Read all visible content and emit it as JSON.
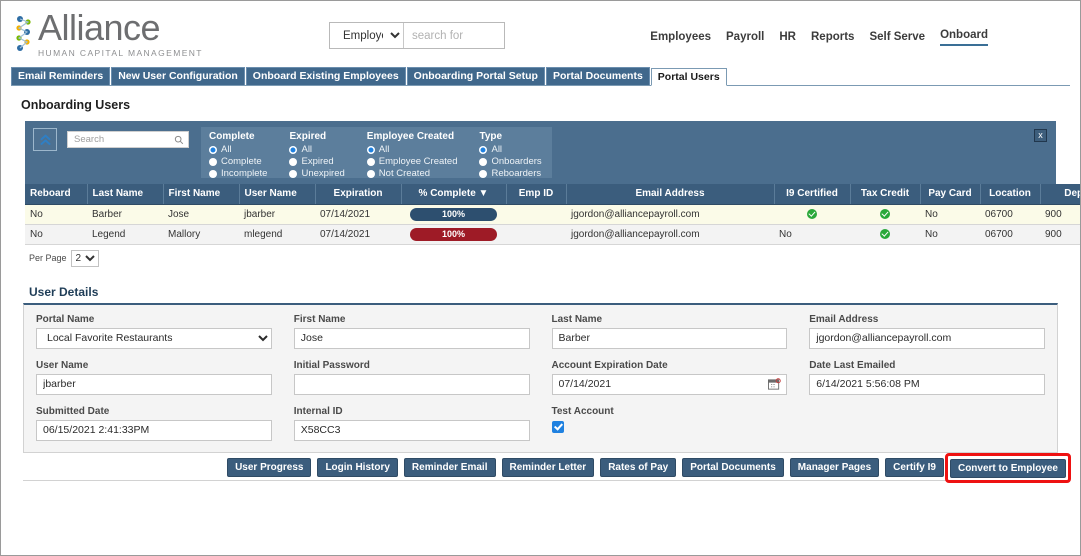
{
  "brand": {
    "name": "Alliance",
    "tagline": "HUMAN CAPITAL MANAGEMENT",
    "colors": {
      "mark_blue": "#2e6da4",
      "mark_green": "#7ab800",
      "mark_yellow": "#f2b100",
      "text_gray": "#6d6e70"
    }
  },
  "header": {
    "search_scope": "Employees",
    "search_placeholder": "search for",
    "search_value": "",
    "nav": [
      {
        "label": "Employees",
        "active": false
      },
      {
        "label": "Payroll",
        "active": false
      },
      {
        "label": "HR",
        "active": false
      },
      {
        "label": "Reports",
        "active": false
      },
      {
        "label": "Self Serve",
        "active": false
      },
      {
        "label": "Onboard",
        "active": true
      }
    ]
  },
  "tabs": [
    {
      "label": "Email Reminders",
      "active": false
    },
    {
      "label": "New User Configuration",
      "active": false
    },
    {
      "label": "Onboard Existing Employees",
      "active": false
    },
    {
      "label": "Onboarding Portal Setup",
      "active": false
    },
    {
      "label": "Portal Documents",
      "active": false
    },
    {
      "label": "Portal Users",
      "active": true
    }
  ],
  "page_title": "Onboarding Users",
  "filter": {
    "search_placeholder": "Search",
    "search_value": "",
    "close_label": "x",
    "groups": [
      {
        "title": "Complete",
        "options": [
          {
            "label": "All",
            "selected": true
          },
          {
            "label": "Complete",
            "selected": false
          },
          {
            "label": "Incomplete",
            "selected": false
          }
        ]
      },
      {
        "title": "Expired",
        "options": [
          {
            "label": "All",
            "selected": true
          },
          {
            "label": "Expired",
            "selected": false
          },
          {
            "label": "Unexpired",
            "selected": false
          }
        ]
      },
      {
        "title": "Employee Created",
        "options": [
          {
            "label": "All",
            "selected": true
          },
          {
            "label": "Employee Created",
            "selected": false
          },
          {
            "label": "Not Created",
            "selected": false
          }
        ]
      },
      {
        "title": "Type",
        "options": [
          {
            "label": "All",
            "selected": true
          },
          {
            "label": "Onboarders",
            "selected": false
          },
          {
            "label": "Reboarders",
            "selected": false
          }
        ]
      }
    ]
  },
  "table": {
    "columns": [
      "Reboard",
      "Last Name",
      "First Name",
      "User Name",
      "Expiration",
      "% Complete ▼",
      "Emp ID",
      "Email Address",
      "I9 Certified",
      "Tax Credit",
      "Pay Card",
      "Location",
      "Depa"
    ],
    "rows": [
      {
        "reboard": "No",
        "last_name": "Barber",
        "first_name": "Jose",
        "user_name": "jbarber",
        "expiration": "07/14/2021",
        "pct_label": "100%",
        "pct_color": "#2d4f6f",
        "emp_id": "",
        "email": "jgordon@alliancepayroll.com",
        "i9_certified": "check",
        "tax_credit": "check",
        "pay_card": "No",
        "location": "06700",
        "department": "900"
      },
      {
        "reboard": "No",
        "last_name": "Legend",
        "first_name": "Mallory",
        "user_name": "mlegend",
        "expiration": "07/14/2021",
        "pct_label": "100%",
        "pct_color": "#9e1b26",
        "emp_id": "",
        "email": "jgordon@alliancepayroll.com",
        "i9_certified": "No",
        "tax_credit": "check",
        "pay_card": "No",
        "location": "06700",
        "department": "900"
      }
    ],
    "per_page_label": "Per Page",
    "per_page_value": "2"
  },
  "details": {
    "title": "User Details",
    "fields": [
      {
        "label": "Portal Name",
        "value": "Local Favorite Restaurants",
        "kind": "select"
      },
      {
        "label": "First Name",
        "value": "Jose",
        "kind": "text"
      },
      {
        "label": "Last Name",
        "value": "Barber",
        "kind": "text"
      },
      {
        "label": "Email Address",
        "value": "jgordon@alliancepayroll.com",
        "kind": "text"
      },
      {
        "label": "User Name",
        "value": "jbarber",
        "kind": "text"
      },
      {
        "label": "Initial Password",
        "value": "",
        "kind": "text"
      },
      {
        "label": "Account Expiration Date",
        "value": "07/14/2021",
        "kind": "date"
      },
      {
        "label": "Date Last Emailed",
        "value": "6/14/2021 5:56:08 PM",
        "kind": "text"
      },
      {
        "label": "Submitted Date",
        "value": "06/15/2021 2:41:33PM",
        "kind": "text"
      },
      {
        "label": "Internal ID",
        "value": "X58CC3",
        "kind": "text"
      },
      {
        "label": "Test Account",
        "value": "",
        "kind": "checkbox",
        "checked": true
      },
      {
        "label": "",
        "value": "",
        "kind": "empty"
      }
    ]
  },
  "actions": [
    {
      "label": "User Progress",
      "highlighted": false
    },
    {
      "label": "Login History",
      "highlighted": false
    },
    {
      "label": "Reminder Email",
      "highlighted": false
    },
    {
      "label": "Reminder Letter",
      "highlighted": false
    },
    {
      "label": "Rates of Pay",
      "highlighted": false
    },
    {
      "label": "Portal Documents",
      "highlighted": false
    },
    {
      "label": "Manager Pages",
      "highlighted": false
    },
    {
      "label": "Certify I9",
      "highlighted": false
    },
    {
      "label": "Convert to Employee",
      "highlighted": true
    }
  ],
  "annotation": {
    "color": "#ee1111",
    "target": "Convert to Employee"
  }
}
